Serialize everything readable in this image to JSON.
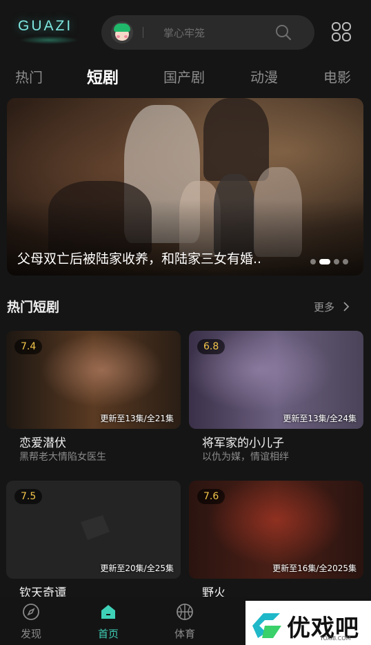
{
  "header": {
    "logo": "GUAZI",
    "search_placeholder": "掌心牢笼"
  },
  "tabs": [
    {
      "label": "热门"
    },
    {
      "label": "短剧"
    },
    {
      "label": "国产剧"
    },
    {
      "label": "动漫"
    },
    {
      "label": "电影"
    }
  ],
  "active_tab": "短剧",
  "banner": {
    "caption": "父母双亡后被陆家收养，和陆家三女有婚..",
    "dot_count": 4,
    "active_dot": 2
  },
  "section": {
    "title": "热门短剧",
    "more_label": "更多"
  },
  "cards": [
    {
      "rating": "7.4",
      "episodes": "更新至13集/全21集",
      "title": "恋爱潜伏",
      "subtitle": "黑帮老大情陷女医生"
    },
    {
      "rating": "6.8",
      "episodes": "更新至13集/全24集",
      "title": "将军家的小儿子",
      "subtitle": "以仇为媒，情谊相绊"
    },
    {
      "rating": "7.5",
      "episodes": "更新至20集/全25集",
      "title": "钦天奇谭",
      "subtitle": ""
    },
    {
      "rating": "7.6",
      "episodes": "更新至16集/全2025集",
      "title": "野火",
      "subtitle": ""
    }
  ],
  "bottom_nav": [
    {
      "label": "发现",
      "icon": "compass-icon"
    },
    {
      "label": "首页",
      "icon": "home-icon"
    },
    {
      "label": "体育",
      "icon": "basketball-icon"
    },
    {
      "label": "",
      "icon": "video-icon"
    },
    {
      "label": "",
      "icon": "profile-icon"
    }
  ],
  "active_nav": "首页",
  "watermark": {
    "text": "优戏吧",
    "url": "YOXI8.COM"
  },
  "colors": {
    "accent": "#3fd1b8",
    "rating": "#f3c64a",
    "background": "#151515"
  }
}
